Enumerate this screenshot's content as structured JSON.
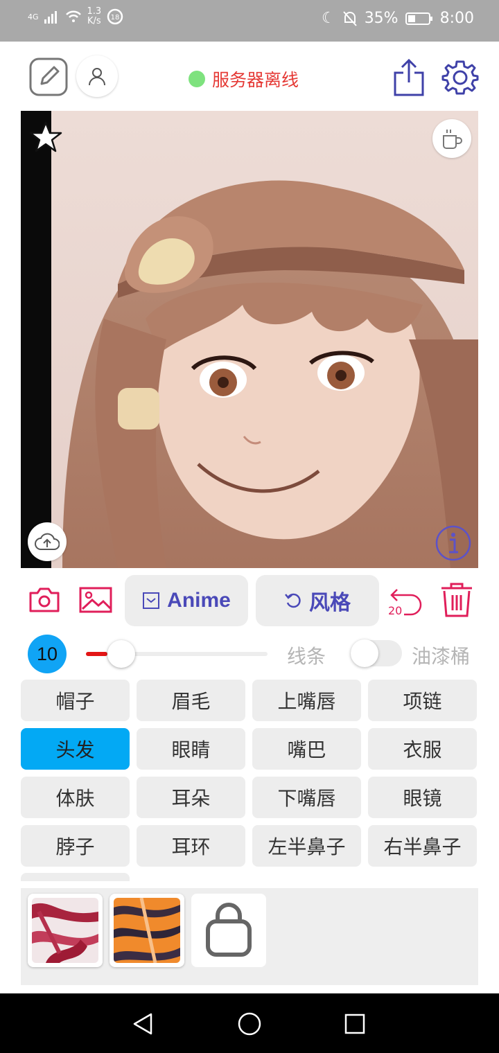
{
  "status_bar": {
    "network": "4G",
    "speed_value": "1.3",
    "speed_unit": "K/s",
    "battery": "35%",
    "time": "8:00"
  },
  "header": {
    "server_status": "服务器离线",
    "status_color": "#7ee27e"
  },
  "tools": {
    "model_button": "Anime",
    "style_button": "风格",
    "undo_count": "20"
  },
  "brush": {
    "size": "10",
    "slider_level": 0.12,
    "mode_line": "线条",
    "mode_bucket": "油漆桶",
    "bucket_enabled": false
  },
  "labels": {
    "items": [
      "帽子",
      "眉毛",
      "上嘴唇",
      "项链",
      "头发",
      "眼睛",
      "嘴巴",
      "衣服",
      "体肤",
      "耳朵",
      "下嘴唇",
      "眼镜",
      "脖子",
      "耳环",
      "左半鼻子",
      "右半鼻子"
    ],
    "selected": "头发"
  },
  "colors": {
    "accent_blue": "#03a9f4",
    "accent_red": "#e01e5a",
    "accent_purple": "#4a49b8",
    "status_red": "#e53935"
  },
  "icons": {
    "edit": "edit-icon",
    "user": "user-icon",
    "share": "share-icon",
    "settings": "gear-icon",
    "favorite": "star-icon",
    "coffee": "coffee-icon",
    "upload": "cloud-upload-icon",
    "info": "info-icon",
    "camera": "camera-icon",
    "gallery": "image-icon",
    "undo": "undo-icon",
    "delete": "trash-icon",
    "shop": "shopping-bag-icon"
  }
}
